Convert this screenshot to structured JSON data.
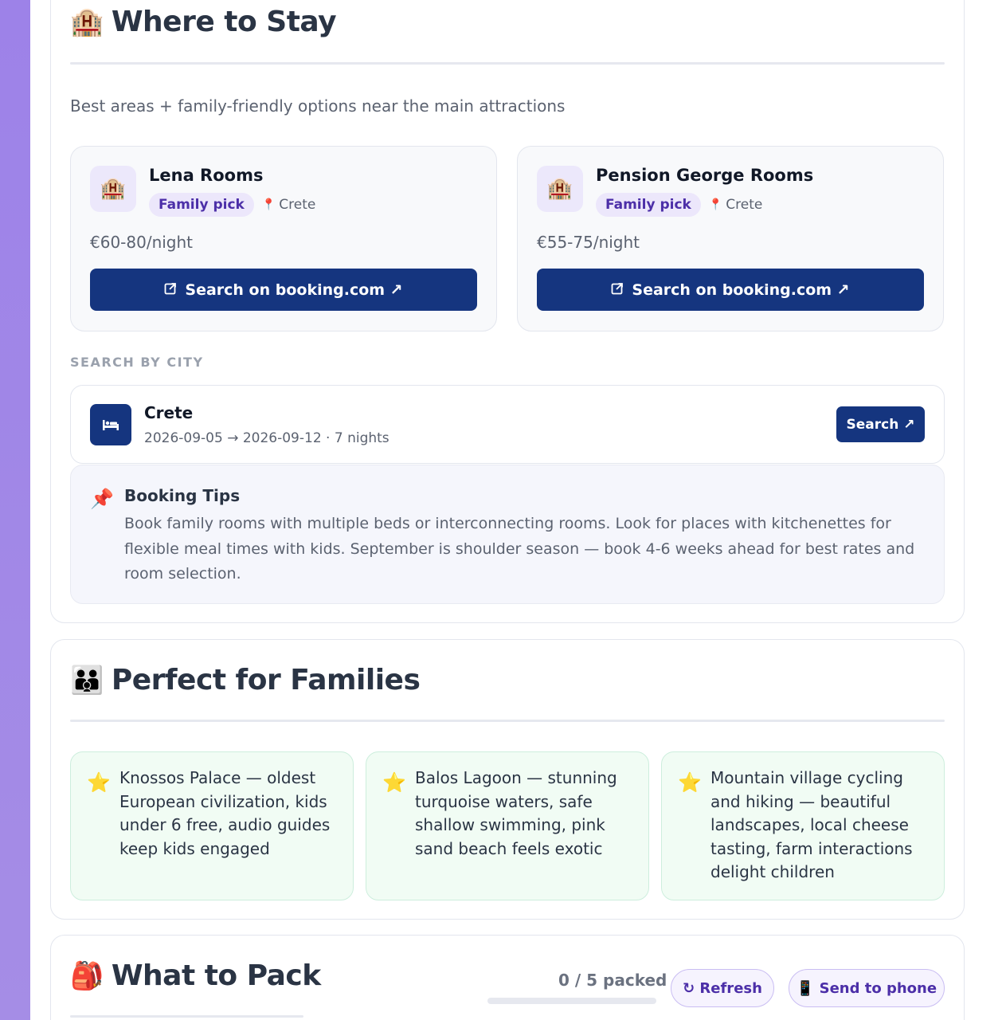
{
  "stay": {
    "icon": "🏨",
    "title": "Where to Stay",
    "subtitle": "Best areas + family-friendly options near the main attractions",
    "hotels": [
      {
        "icon": "🏨",
        "name": "Lena Rooms",
        "badge": "Family pick",
        "location": "Crete",
        "price": "€60-80/night",
        "button_label": "Search on booking.com ↗"
      },
      {
        "icon": "🏨",
        "name": "Pension George Rooms",
        "badge": "Family pick",
        "location": "Crete",
        "price": "€55-75/night",
        "button_label": "Search on booking.com ↗"
      }
    ],
    "search_by_city_label": "SEARCH BY CITY",
    "city": {
      "name": "Crete",
      "dates": "2026-09-05 → 2026-09-12 · 7 nights",
      "button_label": "Search ↗"
    },
    "tips": {
      "title": "Booking Tips",
      "body": "Book family rooms with multiple beds or interconnecting rooms. Look for places with kitchenettes for flexible meal times with kids. September is shoulder season — book 4-6 weeks ahead for best rates and room selection."
    }
  },
  "families": {
    "icon": "👪",
    "title": "Perfect for Families",
    "items": [
      "Knossos Palace — oldest European civilization, kids under 6 free, audio guides keep kids engaged",
      "Balos Lagoon — stunning turquoise waters, safe shallow swimming, pink sand beach feels exotic",
      "Mountain village cycling and hiking — beautiful landscapes, local cheese tasting, farm interactions delight children"
    ]
  },
  "pack": {
    "icon": "🎒",
    "title": "What to Pack",
    "packed_label": "0 / 5 packed",
    "packed_fraction": 0,
    "refresh_label": "↻ Refresh",
    "send_label": "📱 Send to phone"
  }
}
